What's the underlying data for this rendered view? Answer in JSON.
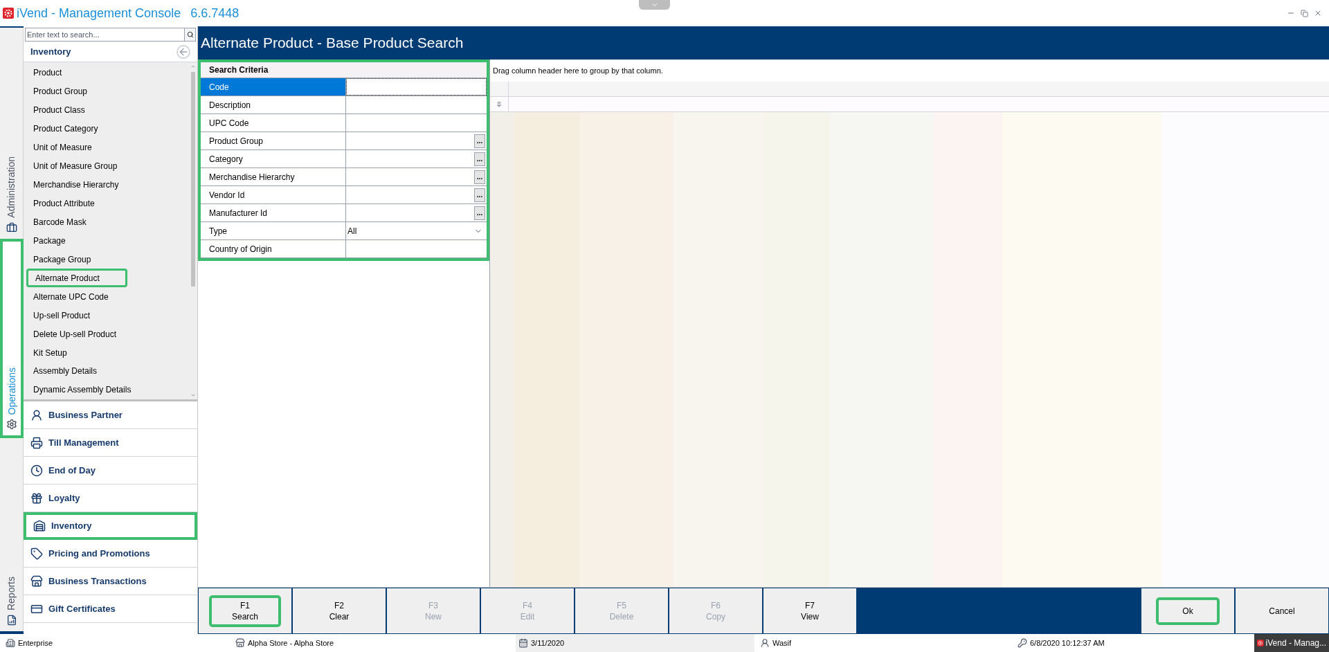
{
  "window": {
    "title": "iVend - Management Console",
    "version": "6.6.7448"
  },
  "side_tabs": [
    {
      "label": "Administration",
      "kind": "briefcase",
      "selected": false,
      "highlighted": false
    },
    {
      "label": "Operations",
      "kind": "gear",
      "selected": true,
      "highlighted": true
    },
    {
      "label": "Reports",
      "kind": "report",
      "selected": false,
      "highlighted": false
    }
  ],
  "sidebar": {
    "search": {
      "placeholder": "Enter text to search..."
    },
    "heading": "Inventory",
    "items": [
      {
        "label": "Product",
        "highlighted": false
      },
      {
        "label": "Product Group",
        "highlighted": false
      },
      {
        "label": "Product Class",
        "highlighted": false
      },
      {
        "label": "Product Category",
        "highlighted": false
      },
      {
        "label": "Unit of Measure",
        "highlighted": false
      },
      {
        "label": "Unit of Measure Group",
        "highlighted": false
      },
      {
        "label": "Merchandise Hierarchy",
        "highlighted": false
      },
      {
        "label": "Product Attribute",
        "highlighted": false
      },
      {
        "label": "Barcode Mask",
        "highlighted": false
      },
      {
        "label": "Package",
        "highlighted": false
      },
      {
        "label": "Package Group",
        "highlighted": false
      },
      {
        "label": "Alternate Product",
        "highlighted": true
      },
      {
        "label": "Alternate UPC Code",
        "highlighted": false
      },
      {
        "label": "Up-sell Product",
        "highlighted": false
      },
      {
        "label": "Delete Up-sell Product",
        "highlighted": false
      },
      {
        "label": "Kit Setup",
        "highlighted": false
      },
      {
        "label": "Assembly Details",
        "highlighted": false
      },
      {
        "label": "Dynamic Assembly Details",
        "highlighted": false
      }
    ],
    "sections": [
      {
        "label": "Business Partner",
        "kind": "user",
        "highlighted": false
      },
      {
        "label": "Till Management",
        "kind": "till",
        "highlighted": false
      },
      {
        "label": "End of Day",
        "kind": "clock",
        "highlighted": false
      },
      {
        "label": "Loyalty",
        "kind": "gift",
        "highlighted": false
      },
      {
        "label": "Inventory",
        "kind": "warehouse",
        "highlighted": true
      },
      {
        "label": "Pricing and Promotions",
        "kind": "tag",
        "highlighted": false
      },
      {
        "label": "Business Transactions",
        "kind": "store",
        "highlighted": false
      },
      {
        "label": "Gift Certificates",
        "kind": "card",
        "highlighted": false
      }
    ]
  },
  "page_title": "Alternate Product - Base Product Search",
  "search_criteria": {
    "title": "Search Criteria",
    "highlighted": true,
    "rows": [
      {
        "label": "Code",
        "kind": "text",
        "selected": true
      },
      {
        "label": "Description",
        "kind": "text",
        "selected": false
      },
      {
        "label": "UPC Code",
        "kind": "text",
        "selected": false
      },
      {
        "label": "Product Group",
        "kind": "lookup",
        "button": "...",
        "selected": false
      },
      {
        "label": "Category",
        "kind": "lookup",
        "button": "...",
        "selected": false
      },
      {
        "label": "Merchandise Hierarchy",
        "kind": "lookup",
        "button": "...",
        "selected": false
      },
      {
        "label": "Vendor Id",
        "kind": "lookup",
        "button": "...",
        "selected": false
      },
      {
        "label": "Manufacturer Id",
        "kind": "lookup",
        "button": "...",
        "selected": false
      },
      {
        "label": "Type",
        "kind": "dropdown",
        "value": "All",
        "selected": false
      },
      {
        "label": "Country of Origin",
        "kind": "text",
        "selected": false
      }
    ]
  },
  "grid": {
    "group_hint": "Drag column header here to group by that column."
  },
  "toolbar": [
    {
      "key": "F1",
      "label": "Search",
      "disabled": false,
      "highlighted": true
    },
    {
      "key": "F2",
      "label": "Clear",
      "disabled": false,
      "highlighted": false
    },
    {
      "key": "F3",
      "label": "New",
      "disabled": true,
      "highlighted": false
    },
    {
      "key": "F4",
      "label": "Edit",
      "disabled": true,
      "highlighted": false
    },
    {
      "key": "F5",
      "label": "Delete",
      "disabled": true,
      "highlighted": false
    },
    {
      "key": "F6",
      "label": "Copy",
      "disabled": true,
      "highlighted": false
    },
    {
      "key": "F7",
      "label": "View",
      "disabled": false,
      "highlighted": false
    }
  ],
  "dialog_buttons": [
    {
      "label": "Ok",
      "highlighted": true
    },
    {
      "label": "Cancel",
      "highlighted": false
    }
  ],
  "status_bar": [
    {
      "text": "Enterprise",
      "kind": "building"
    },
    {
      "text": "Alpha Store - Alpha Store",
      "kind": "store"
    },
    {
      "text": "3/11/2020",
      "kind": "calendar"
    },
    {
      "text": "Wasif",
      "kind": "user"
    },
    {
      "text": "6/8/2020 10:12:37 AM",
      "kind": "key"
    }
  ],
  "taskbar_item": "iVend - Manag..."
}
